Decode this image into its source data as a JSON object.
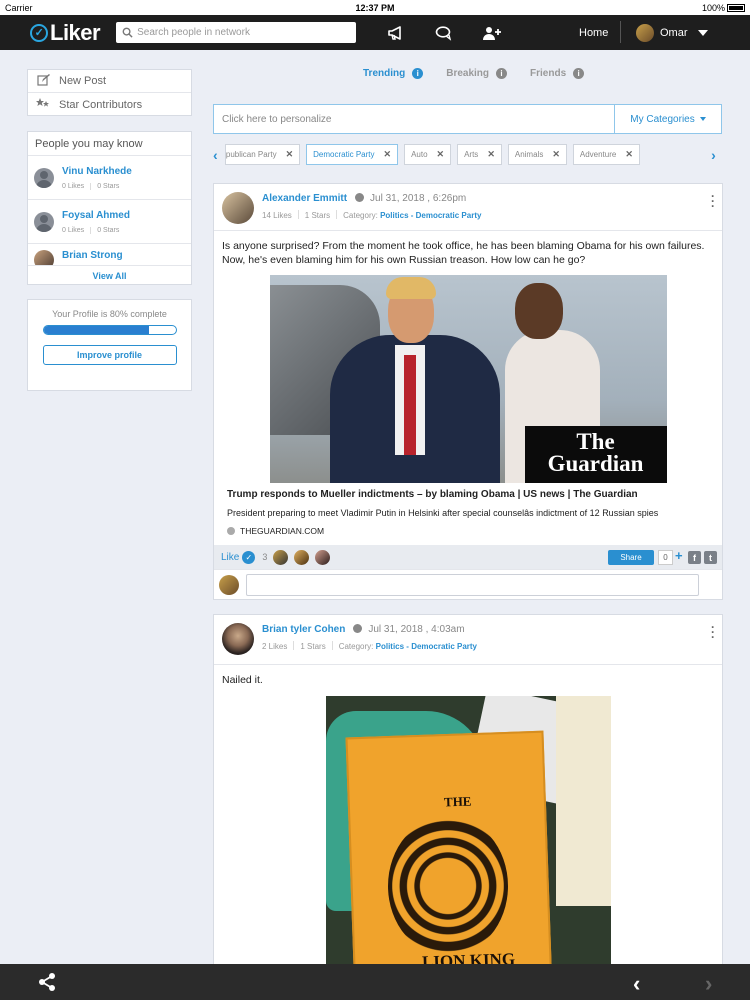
{
  "status_bar": {
    "carrier": "Carrier",
    "time": "12:37 PM",
    "battery": "100%"
  },
  "app": {
    "logo_text": "Liker",
    "brand_color": "#2a8fd0"
  },
  "topnav": {
    "search_placeholder": "Search people in network",
    "icons": [
      "megaphone-icon",
      "chat-icon",
      "add-user-icon"
    ],
    "home_label": "Home",
    "user_name": "Omar"
  },
  "sidebar": {
    "menu": [
      {
        "label": "New Post",
        "icon": "edit-icon"
      },
      {
        "label": "Star Contributors",
        "icon": "stars-icon"
      }
    ],
    "people_title": "People you may know",
    "people": [
      {
        "name": "Vinu Narkhede",
        "likes": "0 Likes",
        "stars": "0 Stars"
      },
      {
        "name": "Foysal Ahmed",
        "likes": "0 Likes",
        "stars": "0 Stars"
      },
      {
        "name": "Brian Strong"
      }
    ],
    "view_all": "View All",
    "profile_text": "Your Profile is 80% complete",
    "profile_progress": 0.8,
    "improve_label": "Improve profile"
  },
  "feed": {
    "tabs": [
      {
        "label": "Trending",
        "active": true
      },
      {
        "label": "Breaking",
        "active": false
      },
      {
        "label": "Friends",
        "active": false
      }
    ],
    "personalize_placeholder": "Click here to personalize",
    "my_categories": "My Categories",
    "chips": [
      {
        "label": "publican Party"
      },
      {
        "label": "Democratic Party"
      },
      {
        "label": "Auto"
      },
      {
        "label": "Arts"
      },
      {
        "label": "Animals"
      },
      {
        "label": "Adventure"
      }
    ]
  },
  "posts": [
    {
      "author": "Alexander Emmitt",
      "date": "Jul 31, 2018 , 6:26pm",
      "likes": "14 Likes",
      "stars": "1 Stars",
      "category_label": "Category:",
      "category": "Politics - Democratic Party",
      "text": "Is anyone surprised? From the moment he took office, he has been blaming Obama for his own failures. Now, he's even blaming him for his own Russian treason. How low can he go?",
      "link": {
        "image_brand_line1": "The",
        "image_brand_line2": "Guardian",
        "title": "Trump responds to Mueller indictments – by blaming Obama | US news | The Guardian",
        "description": "President preparing to meet Vladimir Putin in Helsinki after special counselâs indictment of 12 Russian spies",
        "domain": "THEGUARDIAN.COM"
      },
      "like_label": "Like",
      "like_count": "3",
      "share_label": "Share",
      "share_count": "0"
    },
    {
      "author": "Brian tyler Cohen",
      "date": "Jul 31, 2018 , 4:03am",
      "likes": "2 Likes",
      "stars": "1 Stars",
      "category_label": "Category:",
      "category": "Politics - Democratic Party",
      "text": "Nailed it.",
      "image_text_top": "THE",
      "image_text_bottom": "LION KING"
    }
  ]
}
